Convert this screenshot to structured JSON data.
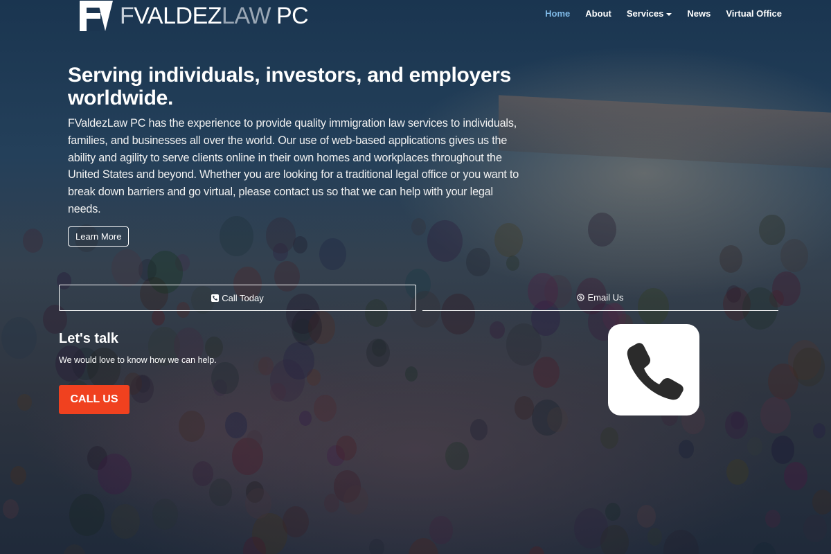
{
  "brand": {
    "name_parts": [
      "F",
      "VALDEZ",
      "LAW",
      "PC"
    ]
  },
  "nav": {
    "items": [
      {
        "label": "Home",
        "active": true
      },
      {
        "label": "About"
      },
      {
        "label": "Services",
        "dropdown": true
      },
      {
        "label": "News"
      },
      {
        "label": "Virtual Office"
      }
    ]
  },
  "hero": {
    "heading": "Serving individuals, investors, and employers worldwide.",
    "body": "FValdezLaw PC has the experience to provide quality immigration law services to individuals, families, and businesses all over the world. Our use of web-based applications gives us the ability and agility to serve clients online in their own homes and workplaces throughout the United States and beyond. Whether you are looking for a traditional legal office or you want to break down barriers and go virtual, please contact us so that we can help with your legal needs.",
    "button_label": "Learn More"
  },
  "contact_bar": {
    "call_label": "Call Today",
    "call_icon": "phone-square-icon",
    "email_label": "Email Us",
    "email_icon": "skype-icon"
  },
  "talk": {
    "heading": "Let's talk",
    "subtext": "We would love to know how we can help.",
    "button_label": "CALL US",
    "button_color": "#f0411f",
    "tile_icon": "phone-handset-icon"
  },
  "colors": {
    "nav_active": "#7fb9e6",
    "text": "#ffffff"
  }
}
